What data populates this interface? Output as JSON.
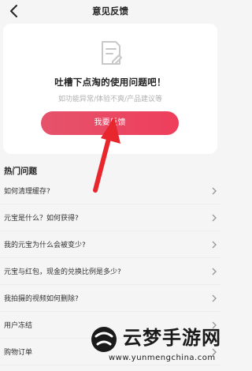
{
  "header": {
    "title": "意见反馈",
    "back_icon": "chevron-left-icon"
  },
  "card": {
    "icon": "document-edit-icon",
    "title": "吐槽下点淘的使用问题吧！",
    "subtitle": "如功能异常/体验不爽/产品建议等",
    "button_label": "我要反馈",
    "button_color": "#ee3e5c"
  },
  "faq": {
    "title": "热门问题",
    "items": [
      {
        "label": "如何清理缓存?"
      },
      {
        "label": "元宝是什么？如何获得?"
      },
      {
        "label": "我的元宝为什么会被变少?"
      },
      {
        "label": "元宝与红包，现金的兑换比例是多少?"
      },
      {
        "label": "我拍摄的视频如何删除?"
      },
      {
        "label": "用户冻结"
      },
      {
        "label": "购物订单"
      }
    ]
  },
  "watermark": {
    "name": "云梦手游网",
    "url": "www.yunmengchina.com"
  }
}
